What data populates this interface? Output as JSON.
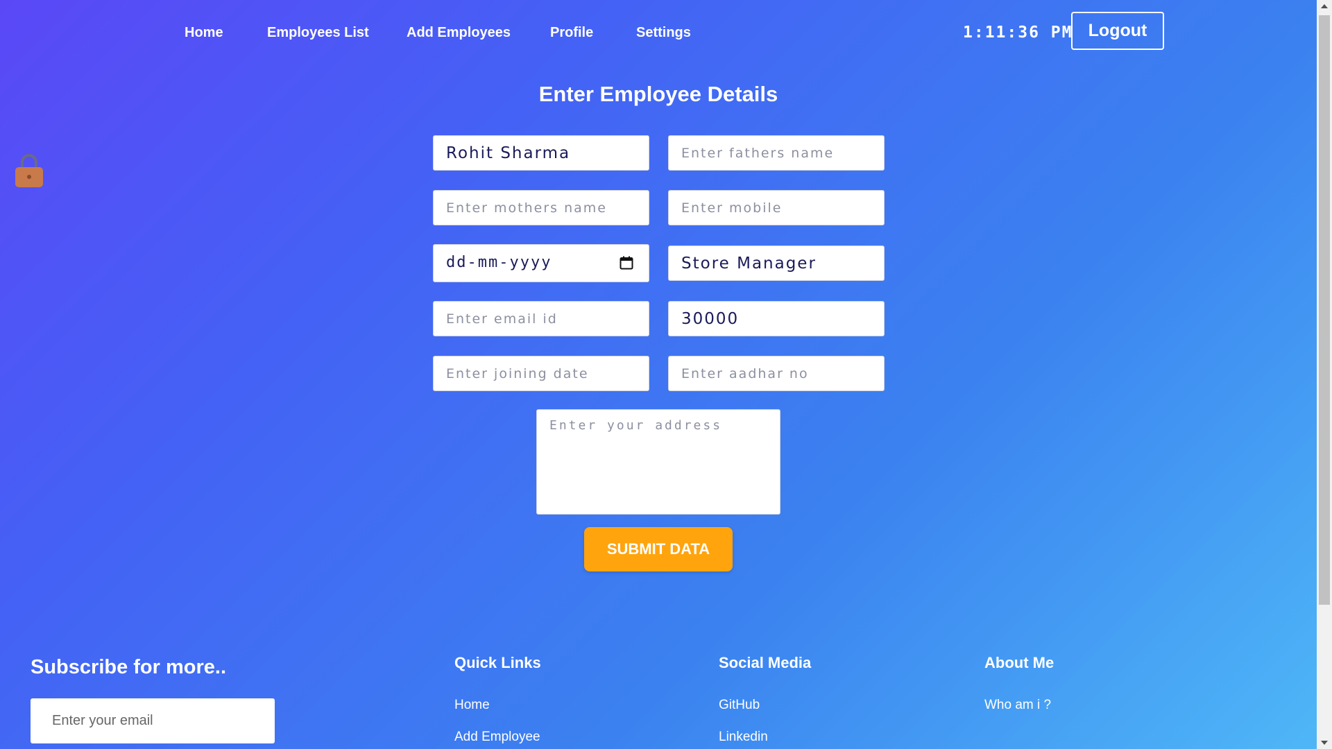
{
  "nav": {
    "items": [
      "Home",
      "Employees List",
      "Add Employees",
      "Profile",
      "Settings"
    ],
    "clock": "1:11:36 PM",
    "logout_label": "Logout"
  },
  "form": {
    "title": "Enter Employee Details",
    "name_value": "Rohit Sharma",
    "fathers_name_placeholder": "Enter fathers name",
    "mothers_name_placeholder": "Enter mothers name",
    "mobile_placeholder": "Enter mobile",
    "dob_value": "dd-mm-yyyy",
    "designation_value": "Store Manager",
    "email_placeholder": "Enter email id",
    "salary_value": "30000",
    "joining_date_placeholder": "Enter joining date",
    "aadhar_placeholder": "Enter aadhar no",
    "address_placeholder": "Enter your address",
    "submit_label": "SUBMIT DATA"
  },
  "footer": {
    "subscribe_title": "Subscribe for more..",
    "subscribe_placeholder": "Enter your email",
    "quick_links_title": "Quick Links",
    "quick_links": [
      "Home",
      "Add Employee"
    ],
    "social_title": "Social Media",
    "social_links": [
      "GitHub",
      "Linkedin"
    ],
    "about_title": "About Me",
    "about_links": [
      "Who am i ?"
    ]
  },
  "colors": {
    "accent_submit": "#ffa40d",
    "lock_icon": "#c87a4a",
    "gradient_start": "#5a48f6",
    "gradient_end": "#4fb8f7"
  }
}
